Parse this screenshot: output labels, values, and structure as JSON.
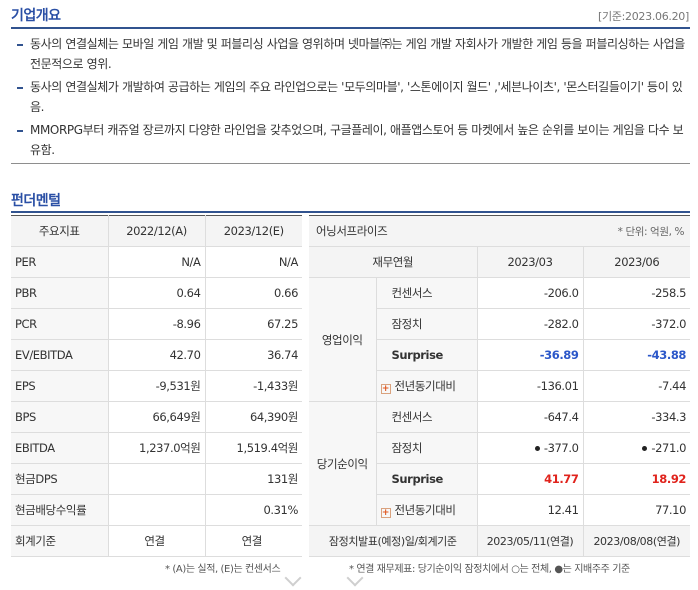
{
  "overview": {
    "title": "기업개요",
    "date": "[기준:2023.06.20]",
    "bullets": [
      "동사의 연결실체는 모바일 게임 개발 및 퍼블리싱 사업을 영위하며 넷마블㈜는 게임 개발 자회사가 개발한 게임 등을 퍼블리싱하는 사업을 전문적으로 영위.",
      "동사의 연결실체가 개발하여 공급하는 게임의 주요 라인업으로는 '모두의마블', '스톤에이지 월드' ,'세븐나이츠', '몬스터길들이기' 등이 있음.",
      "MMORPG부터 캐쥬얼 장르까지 다양한 라인업을 갖추었으며, 구글플레이, 애플앱스토어 등 마켓에서 높은 순위를 보이는 게임을 다수 보유함."
    ]
  },
  "fundamental": {
    "title": "펀더멘털",
    "headers": [
      "주요지표",
      "2022/12(A)",
      "2023/12(E)"
    ],
    "rows": [
      [
        "PER",
        "N/A",
        "N/A"
      ],
      [
        "PBR",
        "0.64",
        "0.66"
      ],
      [
        "PCR",
        "-8.96",
        "67.25"
      ],
      [
        "EV/EBITDA",
        "42.70",
        "36.74"
      ],
      [
        "EPS",
        "-9,531원",
        "-1,433원"
      ],
      [
        "BPS",
        "66,649원",
        "64,390원"
      ],
      [
        "EBITDA",
        "1,237.0억원",
        "1,519.4억원"
      ],
      [
        "현금DPS",
        "",
        "131원"
      ],
      [
        "현금배당수익률",
        "",
        "0.31%"
      ],
      [
        "회계기준",
        "연결",
        "연결"
      ]
    ],
    "note": "* (A)는 실적, (E)는 컨센서스"
  },
  "earnings": {
    "title": "어닝서프라이즈",
    "unit": "* 단위: 억원, %",
    "col_header": "재무연월",
    "periods": [
      "2023/03",
      "2023/06"
    ],
    "op": {
      "label": "영업이익",
      "consensus": {
        "label": "컨센서스",
        "v1": "-206.0",
        "v2": "-258.5"
      },
      "prelim": {
        "label": "잠정치",
        "v1": "-282.0",
        "v2": "-372.0"
      },
      "surprise": {
        "label": "Surprise",
        "v1": "-36.89",
        "v2": "-43.88"
      },
      "yoy": {
        "label": "전년동기대비",
        "v1": "-136.01",
        "v2": "-7.44"
      }
    },
    "net": {
      "label": "당기순이익",
      "consensus": {
        "label": "컨센서스",
        "v1": "-647.4",
        "v2": "-334.3"
      },
      "prelim": {
        "label": "잠정치",
        "v1": "-377.0",
        "v2": "-271.0"
      },
      "surprise": {
        "label": "Surprise",
        "v1": "41.77",
        "v2": "18.92"
      },
      "yoy": {
        "label": "전년동기대비",
        "v1": "12.41",
        "v2": "77.10"
      }
    },
    "footer": {
      "label": "잠정치발표(예정)일/회계기준",
      "v1": "2023/05/11(연결)",
      "v2": "2023/08/08(연결)"
    },
    "note": "* 연결 재무제표: 당기순이익 잠정치에서 ○는 전체, ●는 지배주주 기준",
    "plus_symbol": "+"
  }
}
